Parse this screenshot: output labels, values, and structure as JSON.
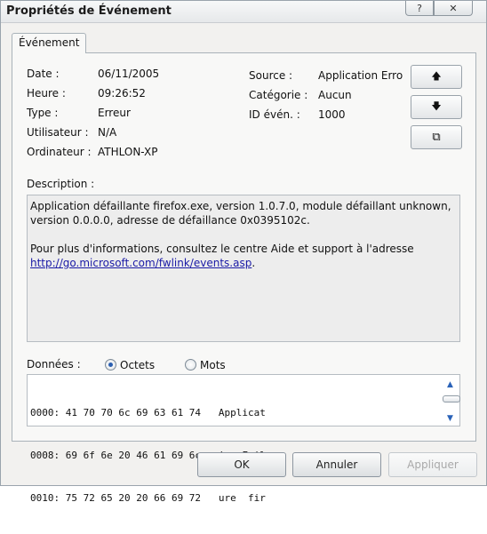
{
  "window": {
    "title": "Propriétés de Événement",
    "help_glyph": "?",
    "close_glyph": "✕"
  },
  "tabs": [
    {
      "label": "Événement"
    }
  ],
  "fields": {
    "date_label": "Date :",
    "date_value": "06/11/2005",
    "time_label": "Heure :",
    "time_value": "09:26:52",
    "type_label": "Type :",
    "type_value": "Erreur",
    "user_label": "Utilisateur :",
    "user_value": "N/A",
    "computer_label": "Ordinateur :",
    "computer_value": "ATHLON-XP",
    "source_label": "Source :",
    "source_value": "Application Erro",
    "category_label": "Catégorie :",
    "category_value": "Aucun",
    "event_id_label": "ID évén. :",
    "event_id_value": "1000"
  },
  "nav": {
    "up_glyph": "🡅",
    "down_glyph": "🡇",
    "copy_glyph": "⧉"
  },
  "description": {
    "label": "Description :",
    "line1": "Application défaillante firefox.exe, version 1.0.7.0, module défaillant unknown,",
    "line2": "version 0.0.0.0, adresse de défaillance 0x0395102c.",
    "line3": "Pour plus d'informations, consultez le centre Aide et support à l'adresse",
    "link": "http://go.microsoft.com/fwlink/events.asp",
    "link_suffix": "."
  },
  "data": {
    "label": "Données :",
    "option_bytes": "Octets",
    "option_words": "Mots",
    "selected": "Octets",
    "lines": [
      "0000: 41 70 70 6c 69 63 61 74   Applicat",
      "0008: 69 6f 6e 20 46 61 69 6c   ion Fail",
      "0010: 75 72 65 20 20 66 69 72   ure  fir"
    ]
  },
  "buttons": {
    "ok": "OK",
    "cancel": "Annuler",
    "apply": "Appliquer"
  }
}
